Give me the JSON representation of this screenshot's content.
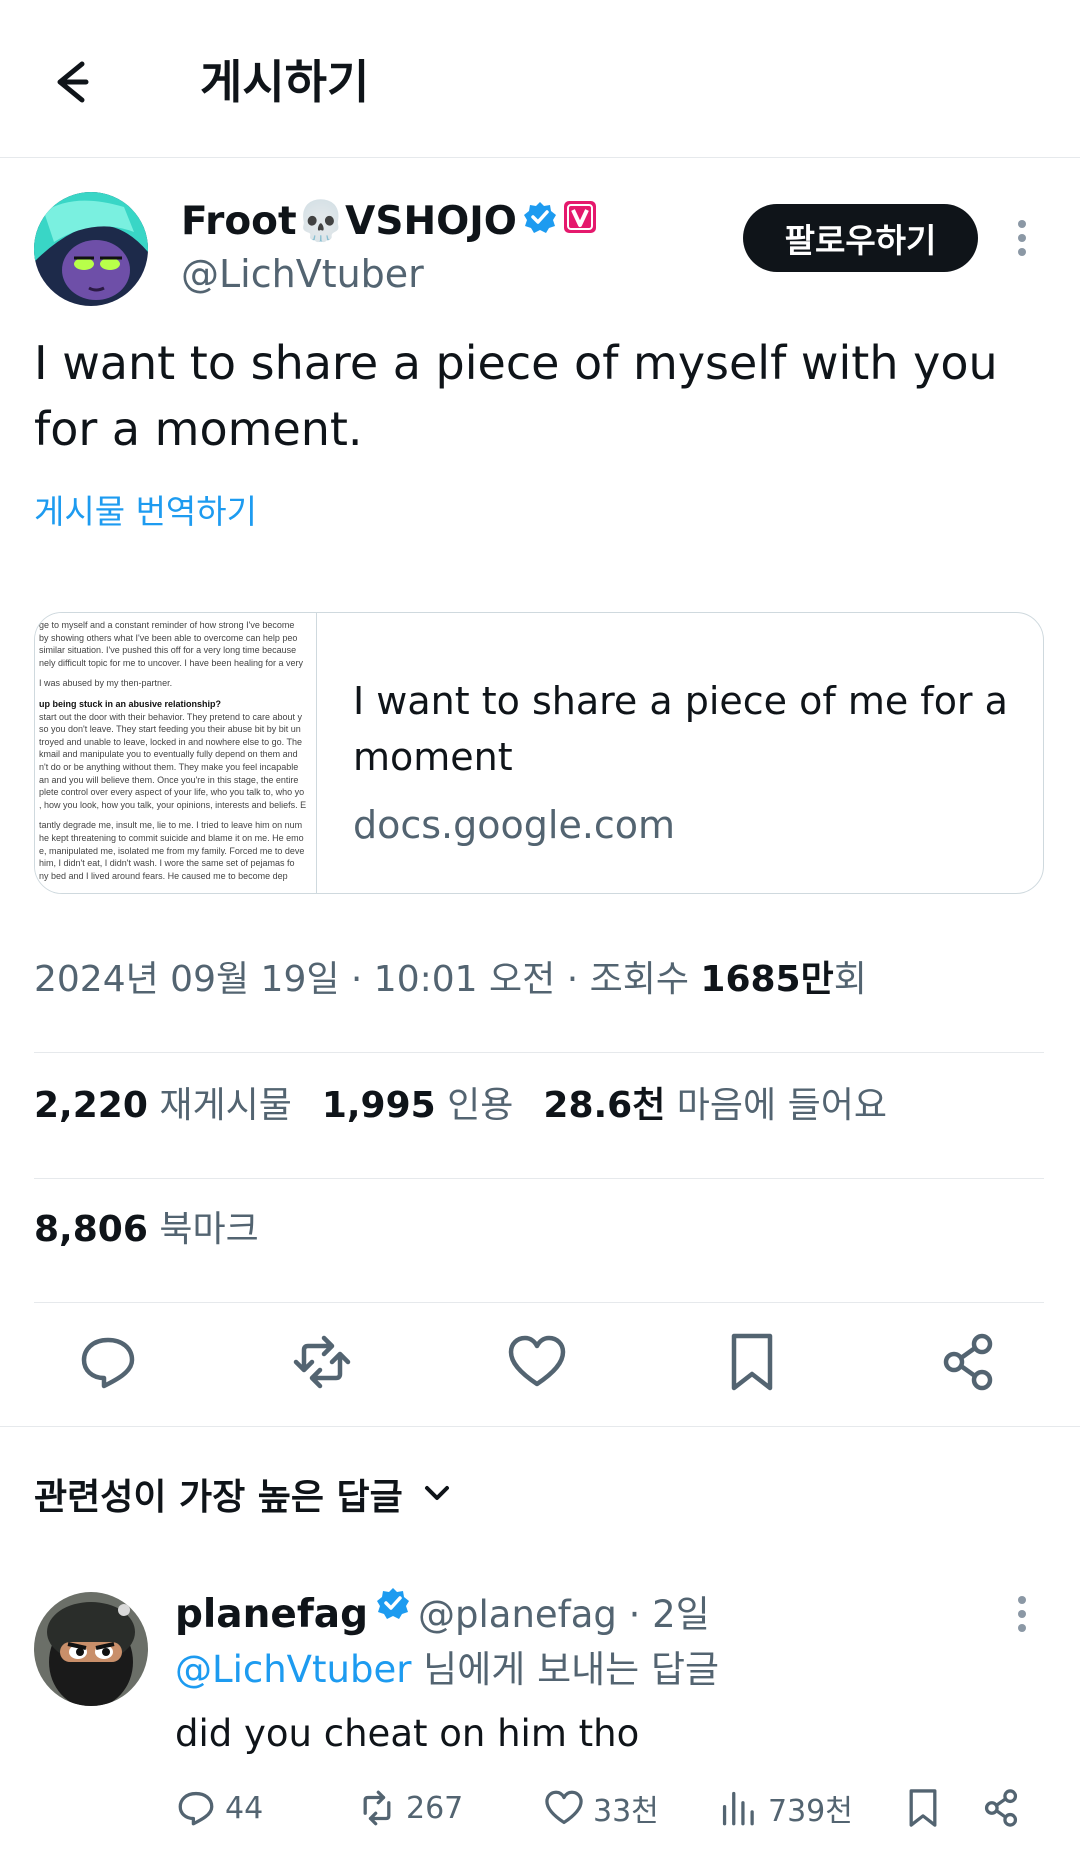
{
  "header": {
    "title": "게시하기"
  },
  "post": {
    "author_name": "Froot💀VSHOJO",
    "author_handle": "@LichVtuber",
    "follow_label": "팔로우하기",
    "text": "I want to share a piece of myself with you for a moment.",
    "translate_label": "게시물 번역하기",
    "link_card": {
      "title": "I want to share a piece of me for a moment",
      "domain": "docs.google.com",
      "thumbnail_lines": [
        "ge to myself and a constant reminder of how strong I've become",
        "by showing others what I've been able to overcome can help peo",
        "similar situation. I've pushed this off for a very long time because",
        "nely difficult topic for me to uncover. I have been healing for a very",
        "",
        "I was abused by my then-partner.",
        "",
        "up being stuck in an abusive relationship?",
        "start out the door with their behavior. They pretend to care about y",
        "so you don't leave. They start feeding you their abuse bit by bit un",
        "troyed and unable to leave, locked in and nowhere else to go. The",
        "kmail and manipulate you to eventually fully depend on them and",
        "n't do or be anything without them. They make you feel incapable",
        "an and you will believe them. Once you're in this stage, the entire",
        "plete control over every aspect of your life, who you talk to, who yo",
        ", how you look, how you talk, your opinions, interests and beliefs. E",
        "",
        "tantly degrade me, insult me, lie to me. I tried to leave him on num",
        "he kept threatening to commit suicide and blame it on me. He emo",
        "e, manipulated me, isolated me from my family. Forced me to deve",
        "him, I didn't eat, I didn't wash. I wore the same set of pejamas fo",
        "ny bed and I lived around fears. He caused me to become dep"
      ]
    },
    "date": "2024년 09월 19일 · 10:01 오전",
    "views_prefix": " · 조회수 ",
    "views": "1685만",
    "views_suffix": "회",
    "stats": {
      "reposts": "2,220",
      "reposts_label": "재게시물",
      "quotes": "1,995",
      "quotes_label": "인용",
      "likes": "28.6천",
      "likes_label": "마음에 들어요",
      "bookmarks": "8,806",
      "bookmarks_label": "북마크"
    }
  },
  "replies_sort_label": "관련성이 가장 높은 답글",
  "reply": {
    "author_name": "planefag",
    "handle_time": "@planefag · 2일",
    "mention": "@LichVtuber",
    "reply_to_suffix": " 님에게 보내는 답글",
    "text": "did you cheat on him tho",
    "counts": {
      "replies": "44",
      "reposts": "267",
      "likes": "33천",
      "views": "739천"
    }
  },
  "colors": {
    "accent": "#1d9bf0",
    "text": "#0f1419",
    "muted": "#536471",
    "divider": "#e6e9ec",
    "vshojo_badge": "#e5196d"
  }
}
